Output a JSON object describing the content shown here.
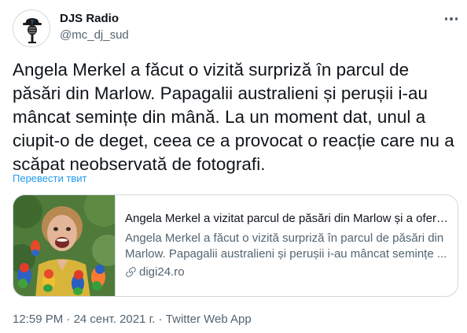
{
  "author": {
    "display_name": "DJS Radio",
    "handle": "@mc_dj_sud"
  },
  "tweet": {
    "text": "Angela Merkel a făcut o vizită surpriză în parcul de păsări din Marlow. Papagalii australieni și perușii i-au mâncat semințe din mână. La un moment dat, unul a ciupit-o de deget, ceea ce a provocat o reacție care nu a scăpat neobservată de fotografi.",
    "translate_label": "Перевести твит"
  },
  "card": {
    "title": "Angela Merkel a vizitat parcul de păsări din Marlow și a oferit...",
    "description_line1": "Angela Merkel a făcut o vizită surpriză în parcul de păsări din",
    "description_line2": "Marlow. Papagalii australieni și perușii i-au mâncat semințe ...",
    "domain": "digi24.ro",
    "domain_icon": "link-icon"
  },
  "meta": {
    "time": "12:59 PM",
    "separator": "·",
    "date": "24 сент. 2021 г.",
    "source": "Twitter Web App"
  },
  "colors": {
    "link_blue": "#1d9bf0",
    "secondary_text": "#536471",
    "border": "#cfd9de"
  }
}
